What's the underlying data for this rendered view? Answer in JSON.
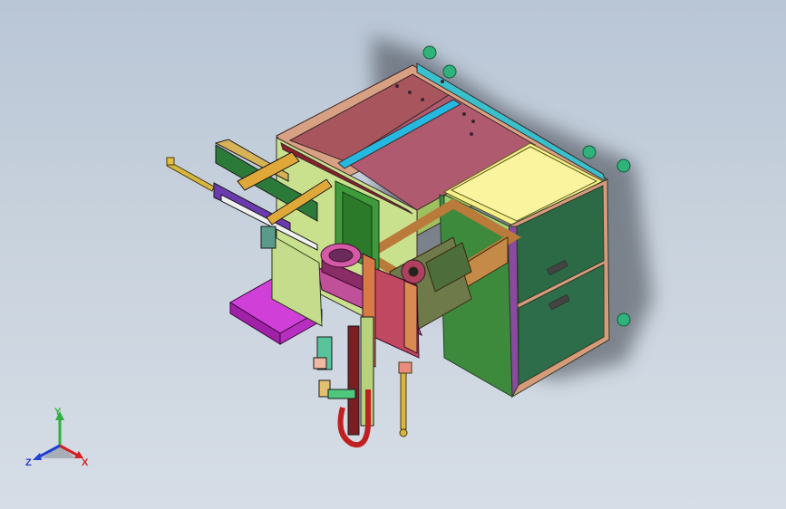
{
  "view": {
    "background_top": "#b9c6d6",
    "background_bottom": "#d6dde6"
  },
  "triad": {
    "x_label": "X",
    "y_label": "Y",
    "z_label": "Z",
    "x_color": "#d42020",
    "y_color": "#2fb040",
    "z_color": "#2040d0"
  }
}
